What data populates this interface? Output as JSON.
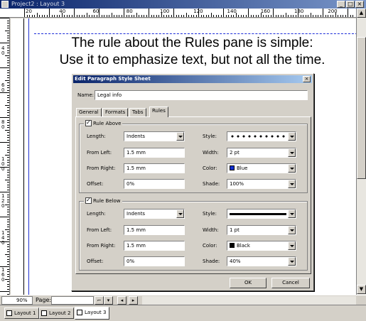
{
  "window": {
    "title": "Project2 : Layout 3",
    "minimize": "_",
    "maximize": "□",
    "close": "×"
  },
  "rulers": {
    "horizontal": [
      "20",
      "40",
      "60",
      "80",
      "100",
      "120",
      "140",
      "160",
      "180",
      "200"
    ],
    "vertical": [
      "4\n0",
      "6\n0",
      "8\n0",
      "1\n0\n0",
      "1\n2\n0",
      "1\n4\n0",
      "1\n6\n0"
    ]
  },
  "page": {
    "headline_line1": "The rule about the Rules pane is simple:",
    "headline_line2": "Use it to emphasize text, but not all the time."
  },
  "status": {
    "zoom": "90%",
    "page_label": "Page:"
  },
  "layout_tabs": [
    "Layout 1",
    "Layout 2",
    "Layout 3"
  ],
  "dialog": {
    "title": "Edit Paragraph Style Sheet",
    "close": "×",
    "name_label": "Name:",
    "name_value": "Legal info",
    "tabs": [
      "General",
      "Formats",
      "Tabs",
      "Rules"
    ],
    "active_tab": "Rules",
    "rule_above": {
      "checkbox_label": "Rule Above",
      "checked": true,
      "length_label": "Length:",
      "length_value": "Indents",
      "from_left_label": "From Left:",
      "from_left_value": "1.5 mm",
      "from_right_label": "From Right:",
      "from_right_value": "1.5 mm",
      "offset_label": "Offset:",
      "offset_value": "0%",
      "style_label": "Style:",
      "style_value": "dotted",
      "width_label": "Width:",
      "width_value": "2 pt",
      "color_label": "Color:",
      "color_value": "Blue",
      "color_hex": "#1030d0",
      "shade_label": "Shade:",
      "shade_value": "100%"
    },
    "rule_below": {
      "checkbox_label": "Rule Below",
      "checked": true,
      "length_label": "Length:",
      "length_value": "Indents",
      "from_left_label": "From Left:",
      "from_left_value": "1.5 mm",
      "from_right_label": "From Right:",
      "from_right_value": "1.5 mm",
      "offset_label": "Offset:",
      "offset_value": "0%",
      "style_label": "Style:",
      "style_value": "solid",
      "width_label": "Width:",
      "width_value": "1 pt",
      "color_label": "Color:",
      "color_value": "Black",
      "color_hex": "#000000",
      "shade_label": "Shade:",
      "shade_value": "40%"
    },
    "ok": "OK",
    "cancel": "Cancel"
  }
}
